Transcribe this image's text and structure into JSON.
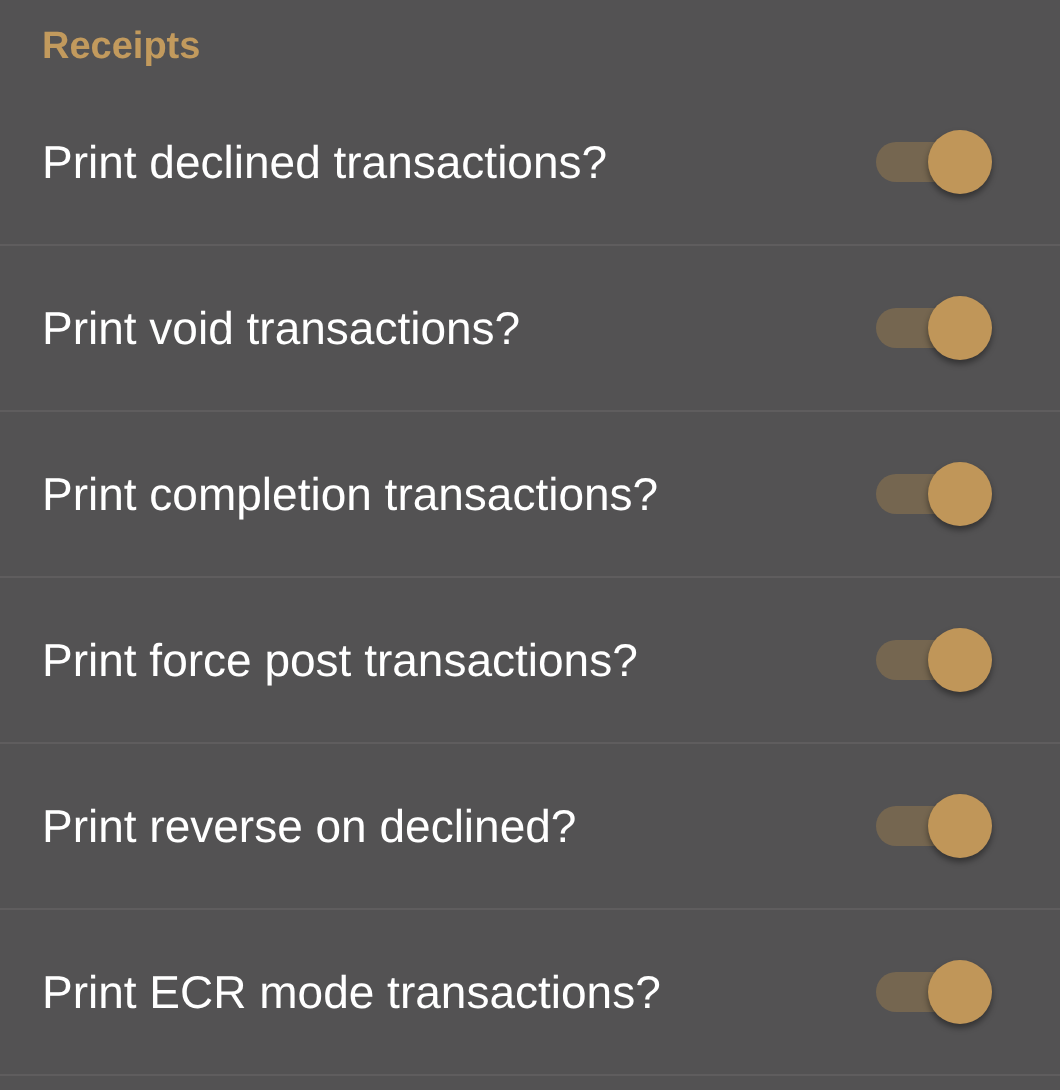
{
  "section": {
    "title": "Receipts"
  },
  "settings": [
    {
      "label": "Print declined transactions?",
      "on": true
    },
    {
      "label": "Print void transactions?",
      "on": true
    },
    {
      "label": "Print completion transactions?",
      "on": true
    },
    {
      "label": "Print force post transactions?",
      "on": true
    },
    {
      "label": "Print reverse on declined?",
      "on": true
    },
    {
      "label": "Print ECR mode transactions?",
      "on": true
    }
  ]
}
